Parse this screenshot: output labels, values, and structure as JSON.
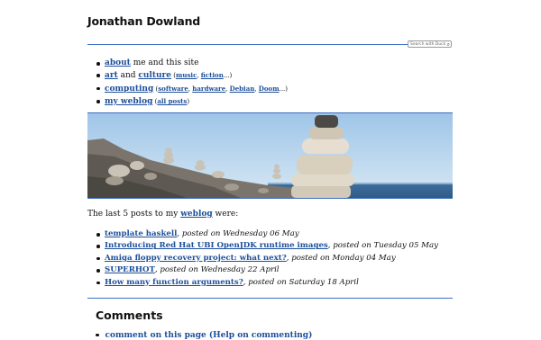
{
  "site": {
    "title": "Jonathan Dowland"
  },
  "search": {
    "placeholder": "Search with Duck",
    "icon": "magnifier-icon"
  },
  "nav": {
    "about": {
      "link": "about",
      "rest": " me and this site"
    },
    "art": {
      "link1": "art",
      "and": " and ",
      "link2": "culture",
      "open": " (",
      "sub1": "music",
      "sep": ", ",
      "sub2": "fiction",
      "close": "...)"
    },
    "computing": {
      "link": "computing",
      "open": " (",
      "sub1": "software",
      "sub2": "hardware",
      "sub3": "Debian",
      "sub4": "Doom",
      "sep": ", ",
      "close": "...)"
    },
    "weblog": {
      "link": "my weblog",
      "open": " (",
      "sub": "all posts",
      "close": ")"
    }
  },
  "intro": {
    "before": "The last 5 posts to my ",
    "link": "weblog",
    "after": " were:"
  },
  "posts": [
    {
      "title": "template haskell",
      "meta": ", posted on Wednesday 06 May"
    },
    {
      "title": "Introducing Red Hat UBI OpenJDK runtime images",
      "meta": ", posted on Tuesday 05 May"
    },
    {
      "title": "Amiga floppy recovery project: what next?",
      "meta": ", posted on Monday 04 May"
    },
    {
      "title": "SUPERHOT",
      "meta": ", posted on Wednesday 22 April"
    },
    {
      "title": "How many function arguments?",
      "meta": ", posted on Saturday 18 April"
    }
  ],
  "comments": {
    "title": "Comments",
    "link_partial": "comment on this page (Help on commenting)"
  },
  "colors": {
    "accent_rule": "#3f6fbf",
    "link": "#1d4f9a"
  }
}
